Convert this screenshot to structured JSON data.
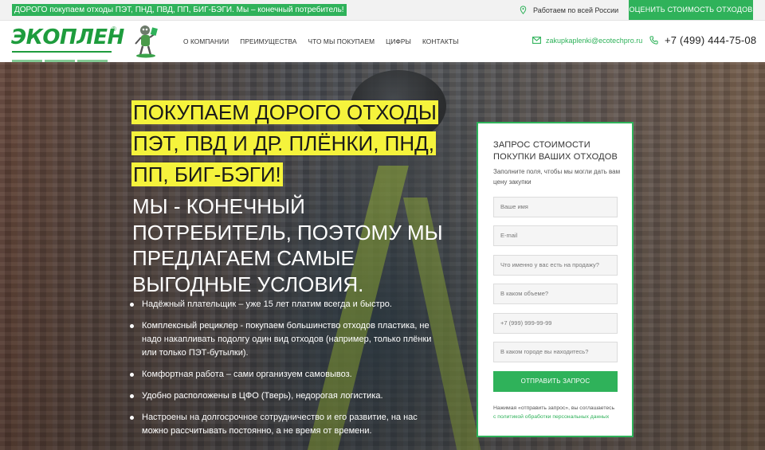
{
  "topbar": {
    "promo": "ДОРОГО покупаем отходы ПЭТ, ПНД, ПВД, ПП, БИГ-БЭГИ. Мы – конечный потребитель!",
    "region": "Работаем по всей России",
    "cta": "ОЦЕНИТЬ СТОИМОСТЬ ОТХОДОВ"
  },
  "header": {
    "logo_text": "ЭКОПЛЕН",
    "logo_reg": "®",
    "nav": [
      "О КОМПАНИИ",
      "ПРЕИМУЩЕСТВА",
      "ЧТО МЫ ПОКУПАЕМ",
      "ЦИФРЫ",
      "КОНТАКТЫ"
    ],
    "email": "zakupkaplenki@ecotechpro.ru",
    "phone": "+7 (499) 444-75-08"
  },
  "hero": {
    "headline_highlight": [
      "ПОКУПАЕМ ДОРОГО ОТХОДЫ",
      "ПЭТ, ПВД И ДР. ПЛЁНКИ, ПНД,",
      "ПП, БИГ-БЭГИ!"
    ],
    "headline_white": [
      "МЫ - КОНЕЧНЫЙ",
      "ПОТРЕБИТЕЛЬ, ПОЭТОМУ МЫ",
      "ПРЕДЛАГАЕМ САМЫЕ",
      "ВЫГОДНЫЕ УСЛОВИЯ."
    ],
    "bullets": [
      "Надёжный плательщик – уже 15 лет платим всегда и быстро.",
      "Комплексный рециклер - покупаем большинство отходов пластика, не надо накапливать подолгу один вид отходов (например, только плёнки или только ПЭТ-бутылки).",
      "Комфортная работа – сами организуем самовывоз.",
      "Удобно расположены в ЦФО (Тверь), недорогая логистика.",
      "Настроены на долгосрочное сотрудничество и его развитие, на нас можно рассчитывать постоянно, а не время от времени."
    ]
  },
  "form": {
    "title": "ЗАПРОС СТОИМОСТИ ПОКУПКИ ВАШИХ ОТХОДОВ",
    "subtitle": "Заполните поля, чтобы мы могли дать вам цену закупки",
    "fields": [
      "Ваше имя",
      "E-mail",
      "Что именно у вас есть на продажу?",
      "В каком объеме?",
      "+7 (999) 999-99-99",
      "В каком городе вы находитесь?"
    ],
    "submit": "ОТПРАВИТЬ ЗАПРОС",
    "consent_text": "Нажимая «отправить запрос», вы соглашаетесь",
    "consent_link": "с политикой обработки персональных данных"
  },
  "colors": {
    "brand_green": "#2fb25a",
    "highlight_yellow": "#f5f33c"
  }
}
